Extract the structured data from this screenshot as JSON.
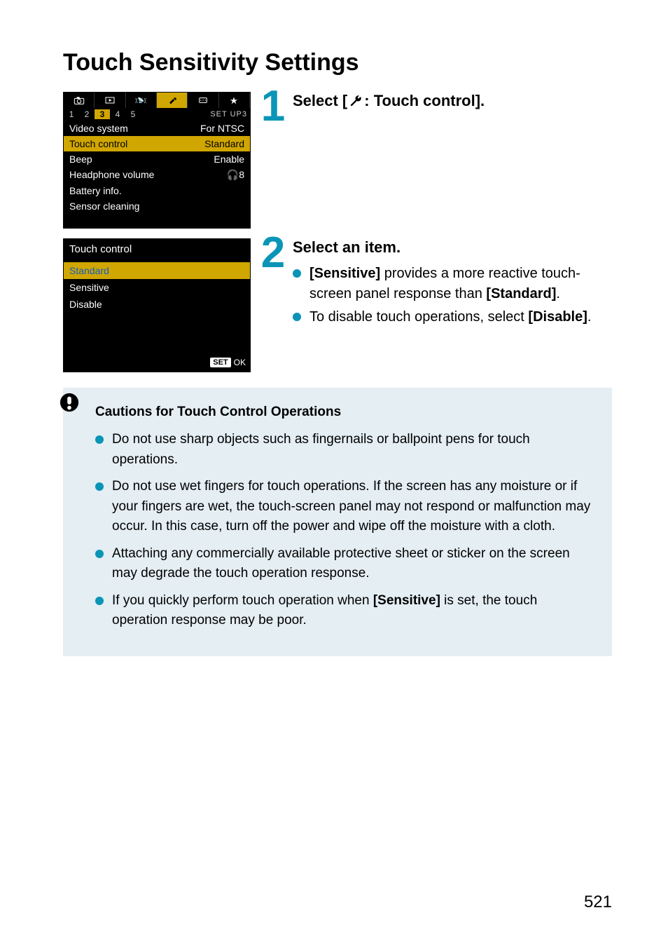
{
  "page": {
    "title": "Touch Sensitivity Settings",
    "number": "521"
  },
  "screen1": {
    "subtabs": [
      "1",
      "2",
      "3",
      "4",
      "5"
    ],
    "subtab_sel_index": 2,
    "subtab_right": "SET UP3",
    "rows": [
      {
        "label": "Video system",
        "value": "For NTSC",
        "sel": false
      },
      {
        "label": "Touch control",
        "value": "Standard",
        "sel": true
      },
      {
        "label": "Beep",
        "value": "Enable",
        "sel": false
      },
      {
        "label": "Headphone volume",
        "value": "🎧8",
        "sel": false
      },
      {
        "label": "Battery info.",
        "value": "",
        "sel": false
      },
      {
        "label": "Sensor cleaning",
        "value": "",
        "sel": false
      }
    ]
  },
  "screen2": {
    "title": "Touch control",
    "options": [
      "Standard",
      "Sensitive",
      "Disable"
    ],
    "selected_index": 0,
    "footer_set": "SET",
    "footer_ok": "OK"
  },
  "step1": {
    "num": "1",
    "pre": "Select [",
    "post": ": Touch control]."
  },
  "step2": {
    "num": "2",
    "head": "Select an item.",
    "bullets": [
      {
        "pre": "",
        "b1": "[Sensitive]",
        "mid": " provides a more reactive touch-screen panel response than ",
        "b2": "[Standard]",
        "post": "."
      },
      {
        "pre": "To disable touch operations, select ",
        "b1": "[Disable]",
        "mid": "",
        "b2": "",
        "post": "."
      }
    ]
  },
  "caution": {
    "title": "Cautions for Touch Control Operations",
    "items": [
      {
        "pre": "Do not use sharp objects such as fingernails or ballpoint pens for touch operations.",
        "b": "",
        "post": ""
      },
      {
        "pre": "Do not use wet fingers for touch operations. If the screen has any moisture or if your fingers are wet, the touch-screen panel may not respond or malfunction may occur. In this case, turn off the power and wipe off the moisture with a cloth.",
        "b": "",
        "post": ""
      },
      {
        "pre": "Attaching any commercially available protective sheet or sticker on the screen may degrade the touch operation response.",
        "b": "",
        "post": ""
      },
      {
        "pre": "If you quickly perform touch operation when ",
        "b": "[Sensitive]",
        "post": " is set, the touch operation response may be poor."
      }
    ]
  }
}
